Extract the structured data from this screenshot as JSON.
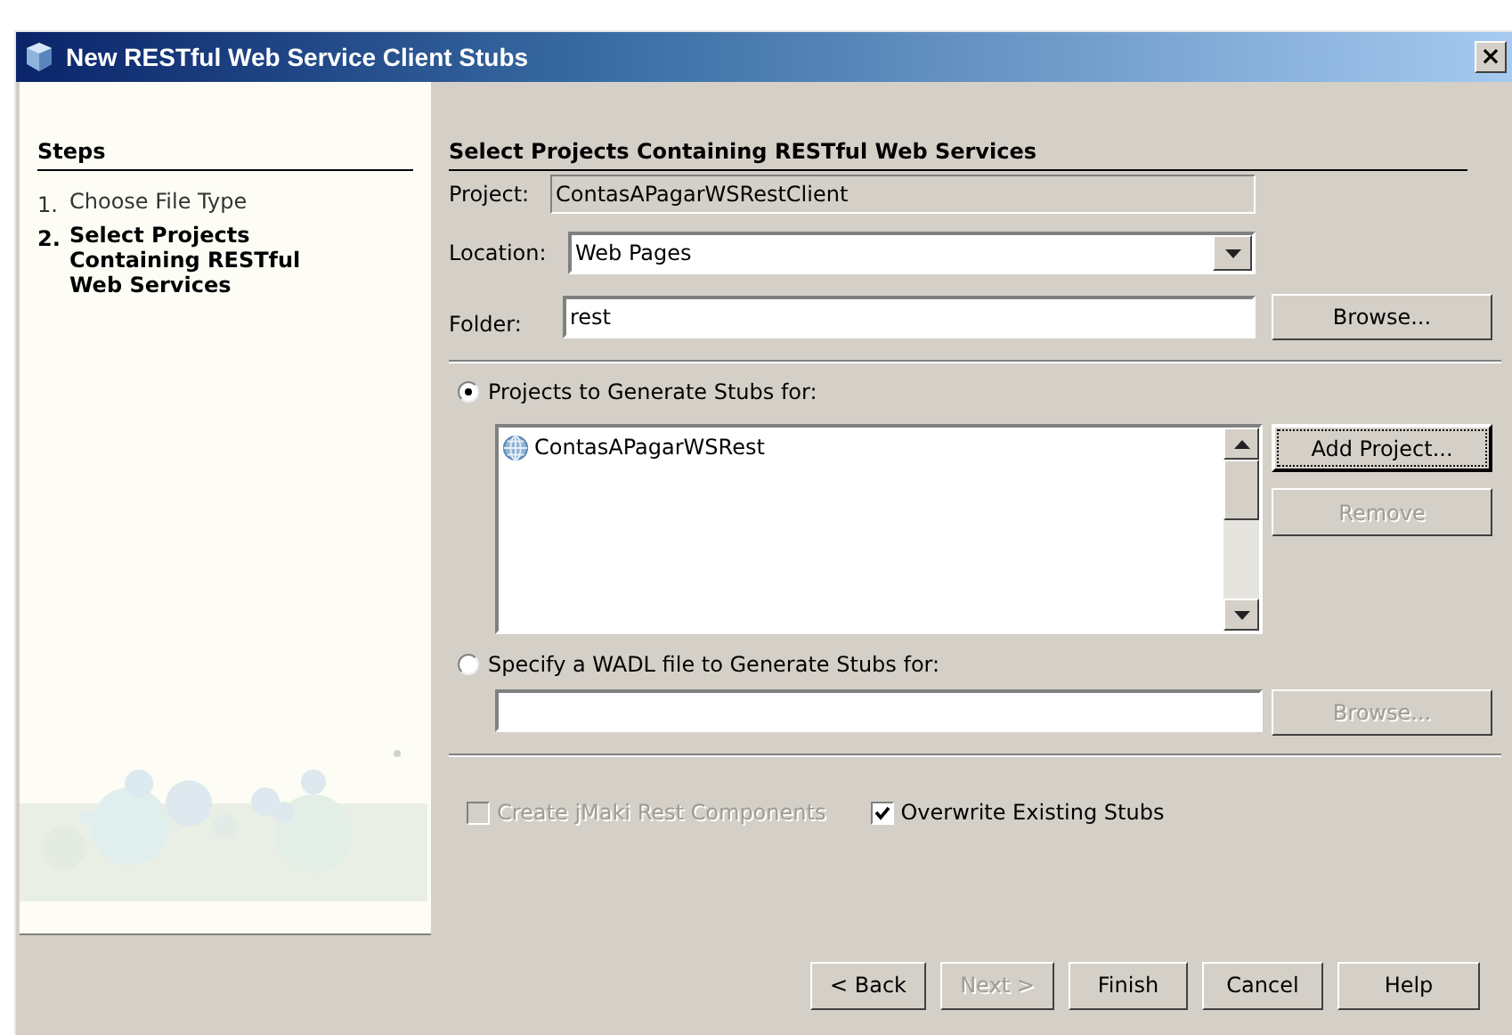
{
  "window": {
    "title": "New RESTful Web Service Client Stubs",
    "close": "×"
  },
  "steps": {
    "heading": "Steps",
    "items": [
      {
        "number": "1.",
        "label": "Choose File Type",
        "selected": false
      },
      {
        "number": "2.",
        "label": "Select Projects Containing RESTful Web Services",
        "selected": true
      }
    ]
  },
  "panel": {
    "heading": "Select Projects Containing RESTful Web Services",
    "project": {
      "label": "Project:",
      "value": "ContasAPagarWSRestClient"
    },
    "location": {
      "label": "Location:",
      "value": "Web Pages"
    },
    "folder": {
      "label": "Folder:",
      "value": "rest",
      "button": {
        "label": "Browse...",
        "disabled": false
      }
    },
    "source_options": [
      {
        "label": "Projects to Generate Stubs for:",
        "selected": true
      },
      {
        "label": "Specify a WADL file to Generate Stubs for:",
        "selected": false
      }
    ],
    "projects": {
      "items": [
        "ContasAPagarWSRest"
      ],
      "buttons": [
        {
          "label": "Add Project...",
          "disabled": false,
          "focused": true
        },
        {
          "label": "Remove",
          "disabled": true,
          "focused": false
        }
      ]
    },
    "wadl": {
      "button": {
        "label": "Browse...",
        "disabled": true
      }
    },
    "checkboxes": [
      {
        "label": "Create jMaki Rest Components",
        "checked": false,
        "disabled": true
      },
      {
        "label": "Overwrite Existing Stubs",
        "checked": true,
        "disabled": false
      }
    ]
  },
  "buttons": [
    {
      "label": "< Back",
      "disabled": false
    },
    {
      "label": "Next >",
      "disabled": true
    },
    {
      "label": "Finish",
      "disabled": false
    },
    {
      "label": "Cancel",
      "disabled": false
    },
    {
      "label": "Help",
      "disabled": false
    }
  ]
}
